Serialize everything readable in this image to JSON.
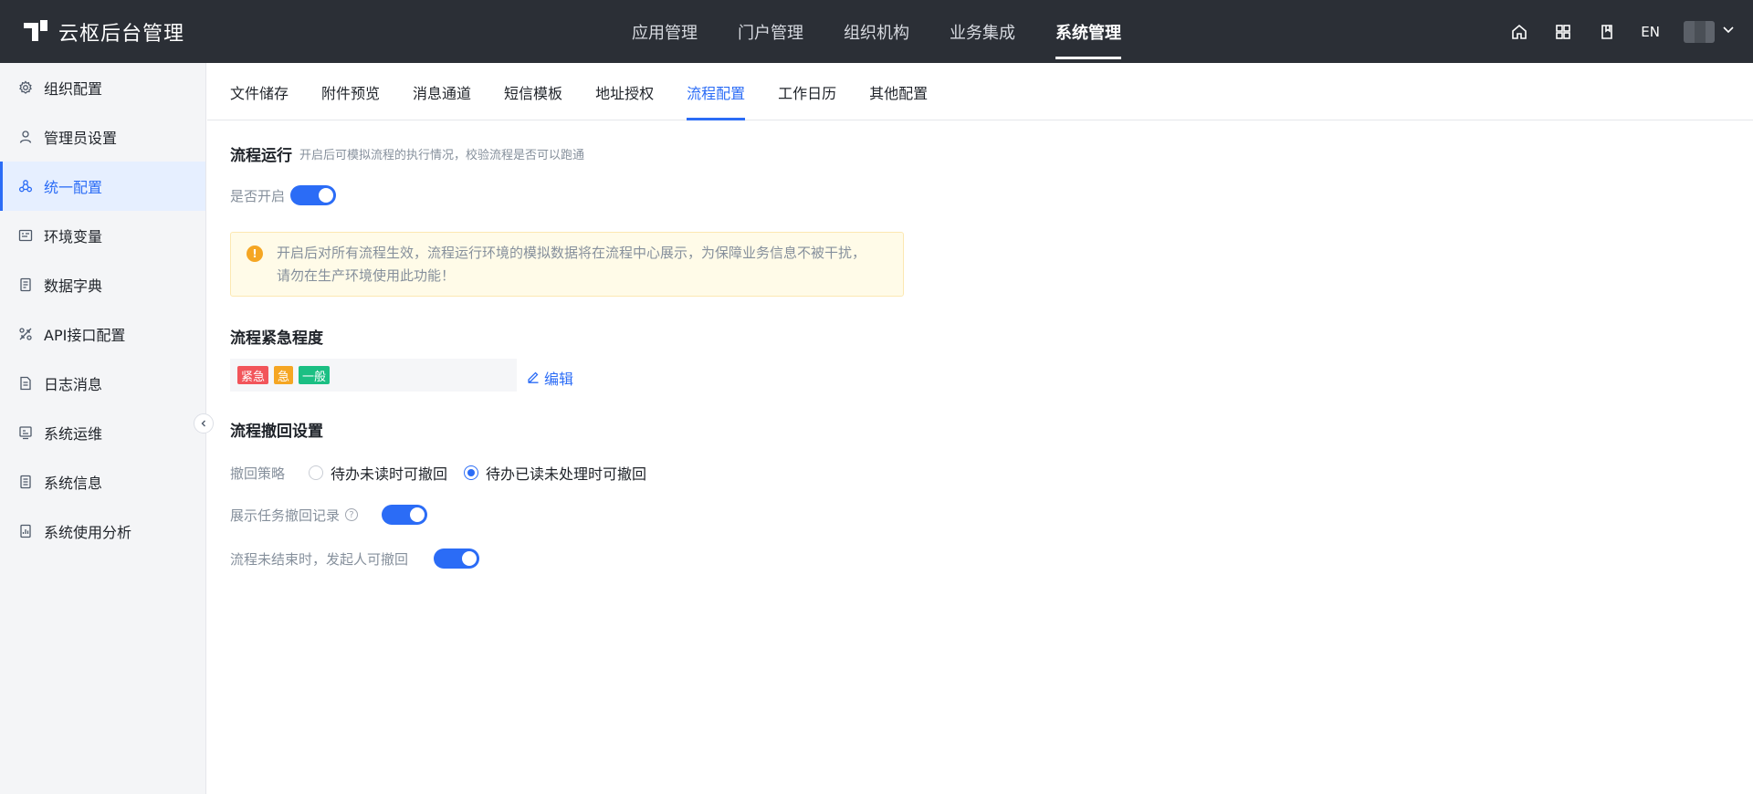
{
  "app": {
    "title": "云枢后台管理"
  },
  "topnav": {
    "items": [
      {
        "label": "应用管理"
      },
      {
        "label": "门户管理"
      },
      {
        "label": "组织机构"
      },
      {
        "label": "业务集成"
      },
      {
        "label": "系统管理"
      }
    ],
    "active_index": 4,
    "lang": "EN"
  },
  "sidebar": {
    "items": [
      {
        "label": "组织配置",
        "icon": "gear-icon"
      },
      {
        "label": "管理员设置",
        "icon": "user-icon"
      },
      {
        "label": "统一配置",
        "icon": "config-icon"
      },
      {
        "label": "环境变量",
        "icon": "variable-icon"
      },
      {
        "label": "数据字典",
        "icon": "dictionary-icon"
      },
      {
        "label": "API接口配置",
        "icon": "api-icon"
      },
      {
        "label": "日志消息",
        "icon": "log-icon"
      },
      {
        "label": "系统运维",
        "icon": "ops-icon"
      },
      {
        "label": "系统信息",
        "icon": "info-icon"
      },
      {
        "label": "系统使用分析",
        "icon": "analysis-icon"
      }
    ],
    "active_index": 2
  },
  "tabs": {
    "items": [
      {
        "label": "文件储存"
      },
      {
        "label": "附件预览"
      },
      {
        "label": "消息通道"
      },
      {
        "label": "短信模板"
      },
      {
        "label": "地址授权"
      },
      {
        "label": "流程配置"
      },
      {
        "label": "工作日历"
      },
      {
        "label": "其他配置"
      }
    ],
    "active_index": 5
  },
  "flow_run": {
    "title": "流程运行",
    "subtitle": "开启后可模拟流程的执行情况，校验流程是否可以跑通",
    "enable_label": "是否开启",
    "enabled": true,
    "alert_line1": "开启后对所有流程生效，流程运行环境的模拟数据将在流程中心展示，为保障业务信息不被干扰，",
    "alert_line2": "请勿在生产环境使用此功能！",
    "alert_icon": "warning-icon"
  },
  "urgency": {
    "title": "流程紧急程度",
    "tags": [
      {
        "label": "紧急",
        "color": "#f2555a"
      },
      {
        "label": "急",
        "color": "#f5a623"
      },
      {
        "label": "一般",
        "color": "#1bbf83"
      }
    ],
    "edit_label": "编辑"
  },
  "withdraw": {
    "title": "流程撤回设置",
    "strategy_label": "撤回策略",
    "options": [
      {
        "label": "待办未读时可撤回",
        "checked": false
      },
      {
        "label": "待办已读未处理时可撤回",
        "checked": true
      }
    ],
    "show_records_label": "展示任务撤回记录",
    "show_records_enabled": true,
    "initiator_label": "流程未结束时，发起人可撤回",
    "initiator_enabled": true
  },
  "colors": {
    "accent": "#2b6cf6",
    "topbar": "#2b2f36"
  }
}
